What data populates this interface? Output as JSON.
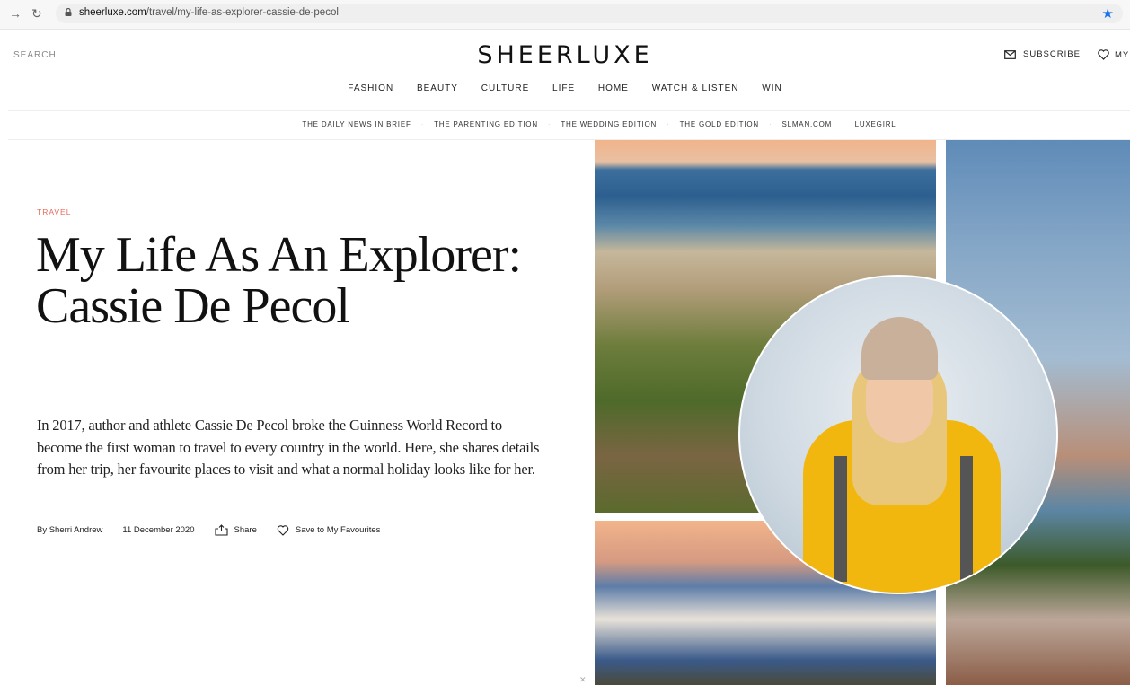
{
  "browser": {
    "url_domain": "sheerluxe.com",
    "url_path": "/travel/my-life-as-explorer-cassie-de-pecol",
    "back_icon": "arrow-right-icon",
    "reload_icon": "reload-icon",
    "bookmark_icon": "star-icon"
  },
  "header": {
    "search_label": "SEARCH",
    "logo": "SHEERLUXE",
    "subscribe_label": "SUBSCRIBE",
    "my_label": "MY",
    "main_nav": [
      "FASHION",
      "BEAUTY",
      "CULTURE",
      "LIFE",
      "HOME",
      "WATCH & LISTEN",
      "WIN"
    ],
    "sub_nav": [
      "THE DAILY NEWS IN BRIEF",
      "THE PARENTING EDITION",
      "THE WEDDING EDITION",
      "THE GOLD EDITION",
      "SLMAN.COM",
      "LUXEGIRL"
    ]
  },
  "article": {
    "category": "TRAVEL",
    "title": "My Life As An Explorer: Cassie De Pecol",
    "lede": "In 2017, author and athlete Cassie De Pecol broke the Guinness World Record to become the first woman to travel to every country in the world. Here, she shares details from her trip, her favourite places to visit and what a normal holiday looks like for her.",
    "author": "By Sherri Andrew",
    "date": "11 December 2020",
    "share_label": "Share",
    "save_label": "Save to My Favourites"
  },
  "colors": {
    "accent": "#e86a5a",
    "bookmark": "#1a73e8"
  }
}
